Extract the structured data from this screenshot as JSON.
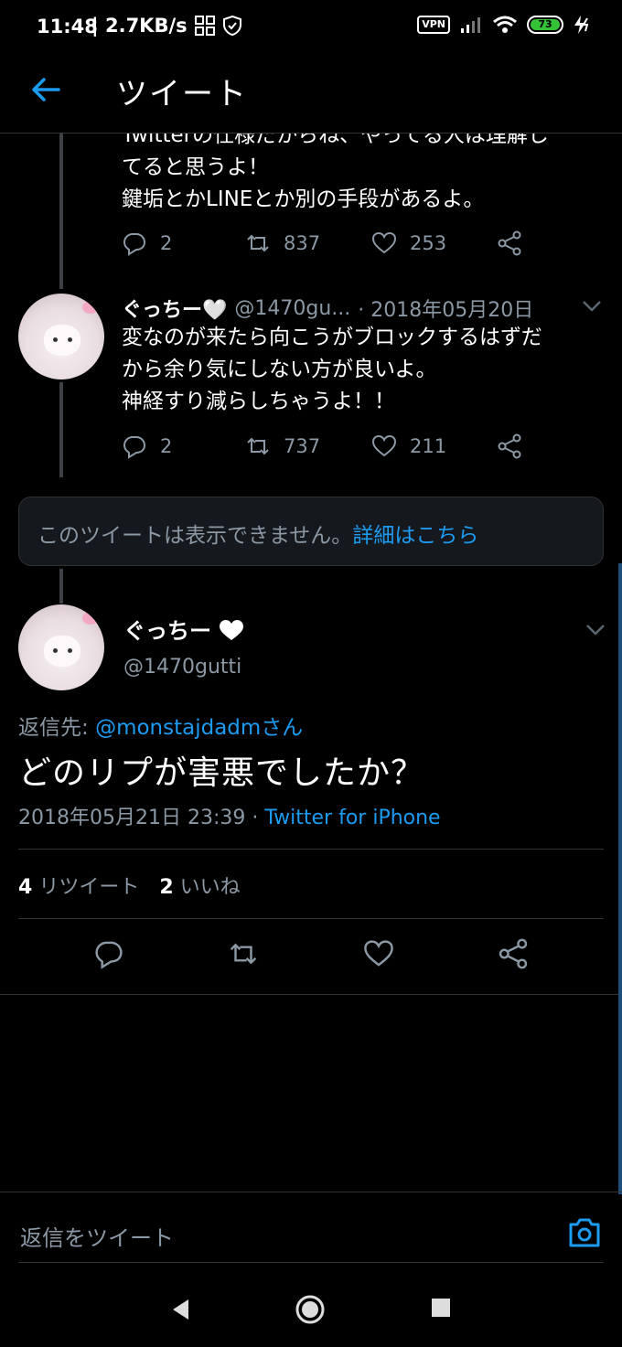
{
  "status_bar": {
    "time": "11:48",
    "speed": "| 2.7KB/s",
    "vpn": "VPN",
    "battery": "73"
  },
  "header": {
    "title": "ツイート"
  },
  "thread": [
    {
      "text_lines": [
        "Twitterの仕様だからね、やってる人は理解し",
        "てると思うよ！",
        "鍵垢とかLINEとか別の手段があるよ。"
      ],
      "replies": "2",
      "retweets": "837",
      "likes": "253"
    },
    {
      "name": "ぐっちー🤍",
      "handle": "@1470gu...",
      "date": "· 2018年05月20日",
      "text_lines": [
        "変なのが来たら向こうがブロックするはずだ",
        "から余り気にしない方が良いよ。",
        "神経すり減らしちゃうよ！！"
      ],
      "replies": "2",
      "retweets": "737",
      "likes": "211"
    }
  ],
  "unavailable": {
    "message": "このツイートは表示できません。",
    "link": "詳細はこちら"
  },
  "main_tweet": {
    "name": "ぐっちー",
    "handle": "@1470gutti",
    "reply_prefix": "返信先: ",
    "reply_mention": "@monstajdadmさん",
    "text": "どのリプが害悪でしたか？",
    "timestamp": "2018年05月21日 23:39 · ",
    "source": "Twitter for iPhone",
    "retweet_count": "4",
    "retweet_label": "リツイート",
    "like_count": "2",
    "like_label": "いいね"
  },
  "composer": {
    "placeholder": "返信をツイート"
  },
  "colors": {
    "accent": "#1d9bf0",
    "background": "#000000",
    "muted": "#8b98a5"
  }
}
